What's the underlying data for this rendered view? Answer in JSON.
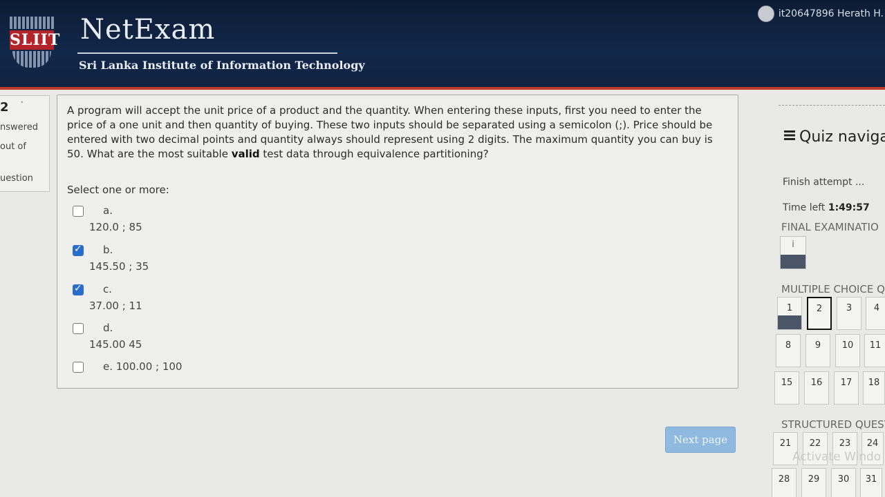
{
  "header": {
    "logo_text": "SLIIT",
    "app_title": "NetExam",
    "subtitle": "Sri Lanka Institute of Information Technology",
    "user_name": "it20647896 Herath H."
  },
  "question_info": {
    "number": "2",
    "status": "nswered",
    "marks": "out of",
    "flag": "uestion"
  },
  "question": {
    "text_before": "A program will accept the unit price of a product and the quantity. When entering these inputs, first you need to enter the price of a one unit and then quantity of buying. These two inputs should be separated using a semicolon (;). Price should be entered with two decimal points and quantity always should represent using 2 digits. The maximum quantity you can buy is 50. What are the most suitable ",
    "text_bold": "valid",
    "text_after": " test data through equivalence partitioning?",
    "prompt": "Select one or more:",
    "options": [
      {
        "letter": "a.",
        "value": "120.0 ; 85",
        "checked": false
      },
      {
        "letter": "b.",
        "value": "145.50 ; 35",
        "checked": true
      },
      {
        "letter": "c.",
        "value": "37.00 ; 11",
        "checked": true
      },
      {
        "letter": "d.",
        "value": "145.00  45",
        "checked": false
      },
      {
        "letter": "e. 100.00 ; 100",
        "value": "",
        "checked": false
      }
    ]
  },
  "next_button": "Next page",
  "nav": {
    "title": "Quiz naviga",
    "finish": "Finish attempt ...",
    "time_label": "Time left ",
    "time_value": "1:49:57",
    "section_final": "FINAL EXAMINATIO",
    "info_tile": "i",
    "section_mcq": "MULTIPLE CHOICE Q",
    "mcq_row1": [
      "1",
      "2",
      "3",
      "4"
    ],
    "mcq_row2": [
      "8",
      "9",
      "10",
      "11"
    ],
    "mcq_row3": [
      "15",
      "16",
      "17",
      "18"
    ],
    "section_structured": "STRUCTURED QUESTI",
    "sq_row1": [
      "21",
      "22",
      "23",
      "24"
    ],
    "sq_row2": [
      "28",
      "29",
      "30",
      "31"
    ],
    "watermark": "Activate Windo"
  },
  "colors": {
    "header_bg": "#12284a",
    "accent_red": "#c0392b",
    "checkbox_checked": "#2a6cc9",
    "next_button": "#8fb9df"
  }
}
